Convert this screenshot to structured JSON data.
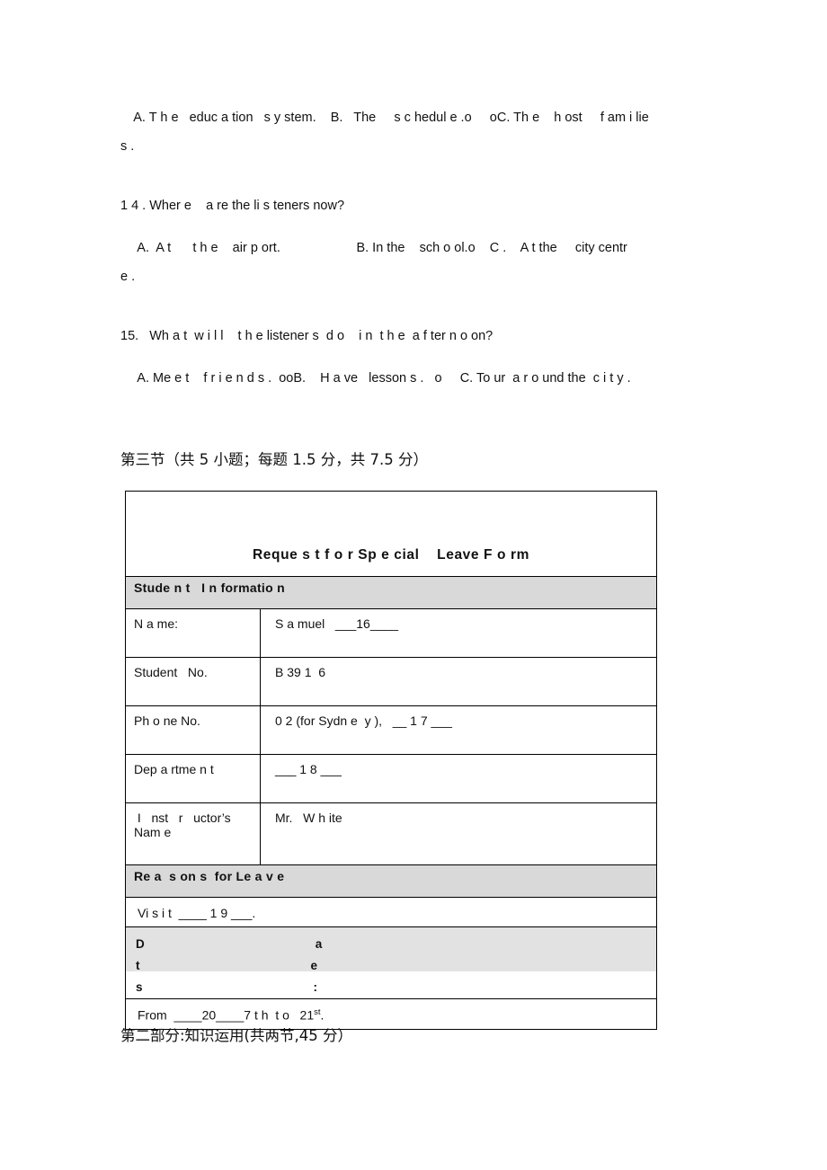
{
  "document": {
    "type": "english-exam-paper",
    "listening_options_q13": "  A. T h e   educ a tion   s y stem.    B.   The     s c hedul e .ᴏ     ᴏC. Th e    h ost     f am i lie",
    "listening_options_q13_cont": "s .",
    "q14": {
      "number_text": "1 4 . Wher e    a re the li s teners now?",
      "options": "   A.  A t      t h e    air p ort.                     B. In the    sch o ol.ᴏ    C .    A t the     city centr",
      "options_cont": "e ."
    },
    "q15": {
      "number_text": "15.   Wh a t  w i l l    t h e listener s  d o    i n  t h e  a f ter n o on?",
      "options": "   A. Me e t    f r i e n d s .  ᴏᴏB.    H a ve   lesson s .   ᴏ     C. To ur  a r o und the  c i t y ."
    },
    "section_heading": "第三节（共 5 小题；每题 1.5 分，共 7.5 分）",
    "part_two_heading": "第二部分:知识运用(共两节,45 分）"
  },
  "form": {
    "title": "Reque s t f o r Sp e cial    Leave F o rm",
    "sections": {
      "student_information": "Stude n t   I n formatio n",
      "reasons_for_leave": "Re a  s on s  for Le a v e"
    },
    "rows": [
      {
        "label": "N a me:",
        "value": "S a muel   ___16____"
      },
      {
        "label": "Student   No.",
        "value": "B 39 1  6"
      },
      {
        "label": "Ph o ne No.",
        "value": "0 2 (for Sydn e  y ),   __ 1 7 ___"
      },
      {
        "label": "Dep a rtme n t",
        "value": "___ 1 8 ___"
      },
      {
        "label": " I   nst   r   uctor’s\nNam e",
        "value": "Mr.   W h ite"
      }
    ],
    "reason_row": "Vi s i t  ____ 1 9 ___.",
    "dates_label": "Dates:",
    "dates_value_prefix": "From  ____20____7 t h  t o   21",
    "dates_value_sup": "st",
    "dates_value_suffix": "."
  },
  "colors": {
    "section_header_bg": "#d9d9d9",
    "dates_band_bg": "#e2e2e2",
    "border": "#000000",
    "text": "#111111"
  }
}
